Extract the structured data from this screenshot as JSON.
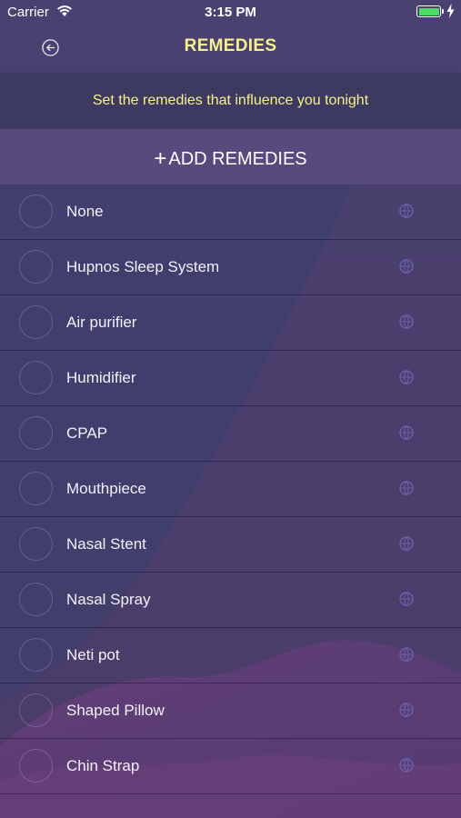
{
  "status_bar": {
    "carrier": "Carrier",
    "time": "3:15 PM",
    "battery_level": 1.0,
    "icons": [
      "wifi-icon",
      "battery-icon",
      "charging-bolt-icon"
    ]
  },
  "nav": {
    "title": "REMEDIES",
    "back_icon": "back-arrow-circle-icon"
  },
  "subtitle": "Set the remedies that influence you tonight",
  "add_button": {
    "plus": "+",
    "label": "ADD REMEDIES"
  },
  "remedies": [
    {
      "label": "None",
      "selected": false
    },
    {
      "label": "Hupnos Sleep System",
      "selected": false
    },
    {
      "label": "Air purifier",
      "selected": false
    },
    {
      "label": "Humidifier",
      "selected": false
    },
    {
      "label": "CPAP",
      "selected": false
    },
    {
      "label": "Mouthpiece",
      "selected": false
    },
    {
      "label": "Nasal Stent",
      "selected": false
    },
    {
      "label": "Nasal Spray",
      "selected": false
    },
    {
      "label": "Neti pot",
      "selected": false
    },
    {
      "label": "Shaped Pillow",
      "selected": false
    },
    {
      "label": "Chin Strap",
      "selected": false
    }
  ],
  "colors": {
    "background": "#473e6a",
    "accent_yellow": "#f6f08e",
    "subtitle_band": "#3c3a60",
    "add_band": "#584a7d",
    "battery_green": "#4cd964"
  }
}
